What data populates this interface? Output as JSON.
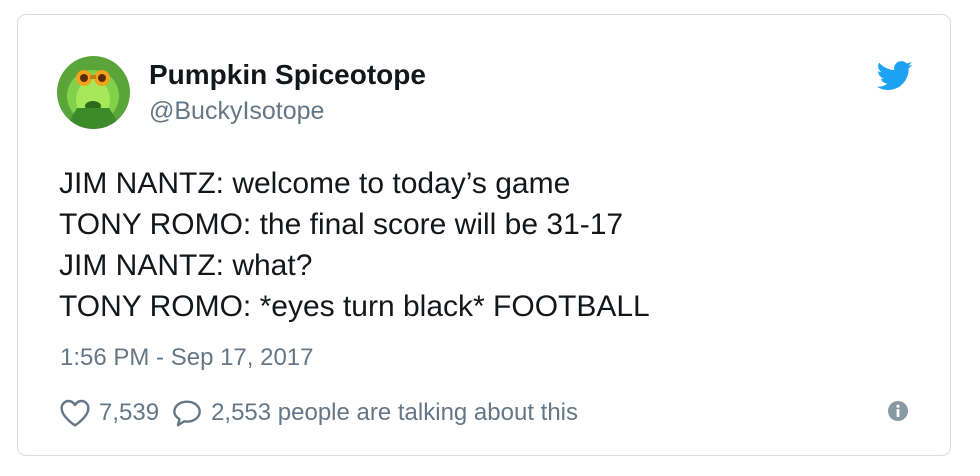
{
  "author": {
    "display_name": "Pumpkin Spiceotope",
    "handle": "@BuckyIsotope",
    "avatar_icon": "avatar-image"
  },
  "brand_icon": "twitter-bird-icon",
  "tweet": {
    "lines": [
      "JIM NANTZ: welcome to today’s game",
      "TONY ROMO: the final score will be 31-17",
      "JIM NANTZ: what?",
      "TONY ROMO: *eyes turn black* FOOTBALL"
    ],
    "timestamp": "1:56 PM - Sep 17, 2017"
  },
  "engagement": {
    "likes": "7,539",
    "talking": "2,553 people are talking about this"
  },
  "colors": {
    "text": "#14171a",
    "secondary": "#657786",
    "twitter_blue": "#1da1f2",
    "border": "#d6dce1"
  }
}
